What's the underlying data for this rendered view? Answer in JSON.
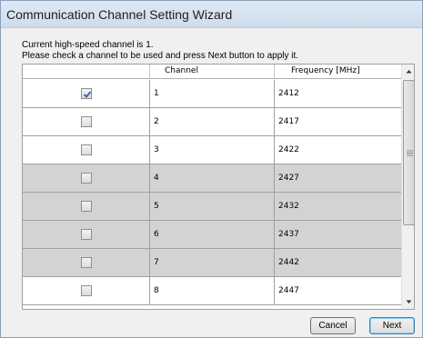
{
  "window": {
    "title": "Communication Channel Setting Wizard"
  },
  "info": {
    "line1": "Current high-speed channel is 1.",
    "line2": "Please check a channel to be used and press Next button to apply it."
  },
  "table": {
    "columns": [
      "",
      "Channel",
      "Frequency [MHz]"
    ],
    "rows": [
      {
        "checked": true,
        "channel": "1",
        "frequency": "2412",
        "shaded": false
      },
      {
        "checked": false,
        "channel": "2",
        "frequency": "2417",
        "shaded": false
      },
      {
        "checked": false,
        "channel": "3",
        "frequency": "2422",
        "shaded": false
      },
      {
        "checked": false,
        "channel": "4",
        "frequency": "2427",
        "shaded": true
      },
      {
        "checked": false,
        "channel": "5",
        "frequency": "2432",
        "shaded": true
      },
      {
        "checked": false,
        "channel": "6",
        "frequency": "2437",
        "shaded": true
      },
      {
        "checked": false,
        "channel": "7",
        "frequency": "2442",
        "shaded": true
      },
      {
        "checked": false,
        "channel": "8",
        "frequency": "2447",
        "shaded": false
      }
    ]
  },
  "buttons": {
    "cancel": "Cancel",
    "next": "Next"
  },
  "colors": {
    "shaded_row": "#d3d3d3",
    "check_mark": "#3a5fa8"
  },
  "icons": {
    "scroll_up": "scroll-up-arrow-icon",
    "scroll_down": "scroll-down-arrow-icon",
    "checkbox": "checkbox-icon"
  }
}
